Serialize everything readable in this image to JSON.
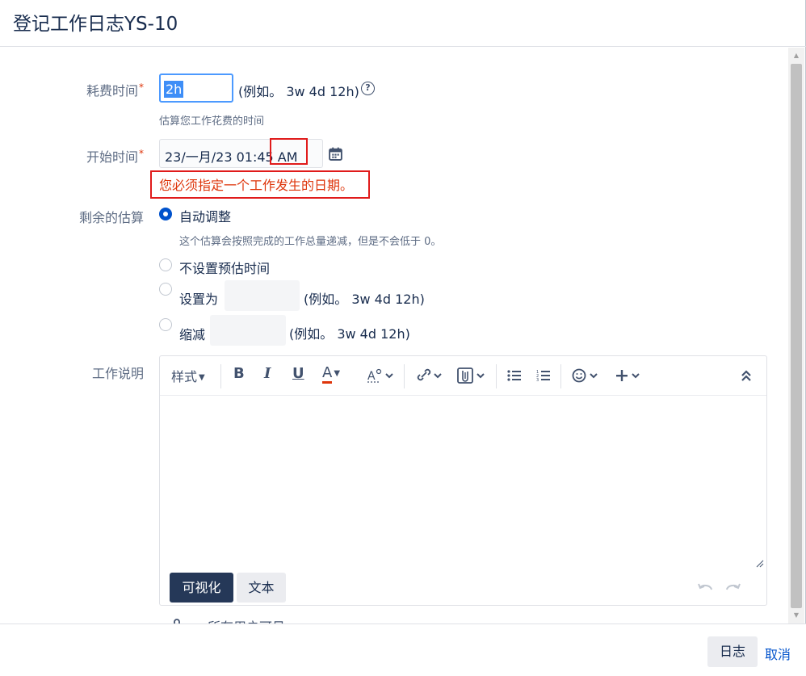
{
  "dialog": {
    "title": "登记工作日志YS-10"
  },
  "time_spent": {
    "label": "耗费时间",
    "required_mark": "*",
    "value": "2h",
    "example": "(例如。 3w 4d 12h)",
    "help_icon": "question-circle-icon",
    "help_text": "估算您工作花费的时间"
  },
  "start_time": {
    "label": "开始时间",
    "required_mark": "*",
    "value": "23/一月/23 01:45 AM",
    "calendar_icon": "calendar-icon",
    "error": "您必须指定一个工作发生的日期。"
  },
  "remaining": {
    "label": "剩余的估算",
    "options": [
      {
        "label": "自动调整",
        "checked": true,
        "description": "这个估算会按照完成的工作总量递减，但是不会低于 0。"
      },
      {
        "label": "不设置预估时间",
        "checked": false
      },
      {
        "label": "设置为",
        "checked": false,
        "example": "(例如。 3w 4d 12h)"
      },
      {
        "label": "缩减",
        "checked": false,
        "example": "(例如。 3w 4d 12h)"
      }
    ]
  },
  "description": {
    "label": "工作说明",
    "toolbar": {
      "style_label": "样式",
      "icons": [
        "bold-icon",
        "italic-icon",
        "underline-icon",
        "text-color-icon",
        "text-format-icon",
        "link-icon",
        "attachment-icon",
        "bullet-list-icon",
        "numbered-list-icon",
        "emoji-icon",
        "plus-icon",
        "collapse-icon"
      ],
      "bold_glyph": "B",
      "italic_glyph": "I",
      "underline_glyph": "U",
      "color_glyph": "A",
      "accent_underline_color": "#de350b"
    },
    "mode_visual": "可视化",
    "mode_text": "文本"
  },
  "visibility": {
    "label": "所有用户可见",
    "icon": "lock-icon"
  },
  "footer": {
    "log_button": "日志",
    "cancel_link": "取消"
  }
}
